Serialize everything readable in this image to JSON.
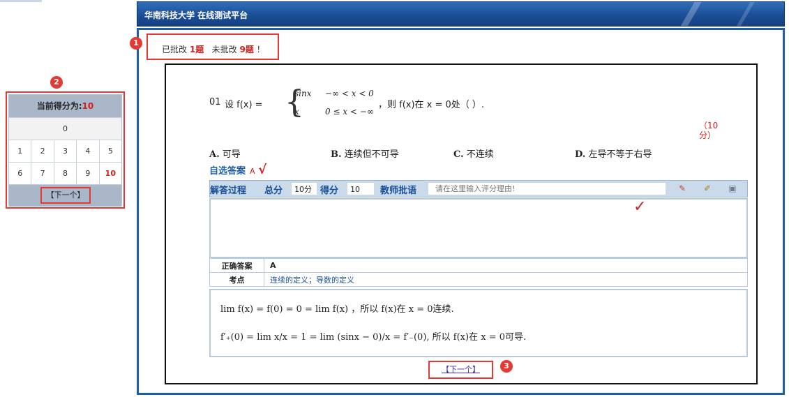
{
  "header": {
    "title": "华南科技大学  在线测试平台"
  },
  "status": {
    "graded_prefix": "已批改",
    "graded_count": "1题",
    "ungraded_prefix": "未批改",
    "ungraded_count": "9题",
    "suffix": "！"
  },
  "badges": [
    "1",
    "2",
    "3"
  ],
  "score_panel": {
    "label": "当前得分为:",
    "value": "10",
    "wide_cell": "0",
    "row1": [
      "1",
      "2",
      "3",
      "4",
      "5"
    ],
    "row2": [
      "6",
      "7",
      "8",
      "9",
      "10"
    ],
    "next_label": "【下一个】"
  },
  "question": {
    "number": "01",
    "pre": "设 f(x) =",
    "case1_expr": "sinx",
    "case1_cond": "−∞ < x < 0",
    "case2_expr": "x",
    "case2_cond": "0 ≤ x < −∞",
    "after": "，则 f(x)在 x = 0处（ ）.",
    "points": "（10分）",
    "options": [
      {
        "letter": "A.",
        "text": "可导"
      },
      {
        "letter": "B.",
        "text": "连续但不可导"
      },
      {
        "letter": "C.",
        "text": "不连续"
      },
      {
        "letter": "D.",
        "text": "左导不等于右导"
      }
    ],
    "self_answer_label": "自选答案",
    "self_answer_value": "A",
    "self_answer_check": "√"
  },
  "grade_bar": {
    "process_label": "解答过程",
    "total_label": "总分",
    "total_value": "10分",
    "score_label": "得分",
    "score_value": "10",
    "comment_label": "教师批语",
    "comment_placeholder": "请在这里输入评分理由!"
  },
  "info": {
    "correct_label": "正确答案",
    "correct_value": "A",
    "topic_label": "考点",
    "topic_value": "连续的定义；导数的定义"
  },
  "solution": {
    "line1": "lim f(x) = f(0) = 0 = lim f(x) ，所以 f(x)在 x = 0连续.",
    "line2": "f′₊(0) = lim x/x = 1 = lim (sinx − 0)/x = f′₋(0), 所以 f(x)在 x = 0可导."
  },
  "next_button": "【下一个】"
}
